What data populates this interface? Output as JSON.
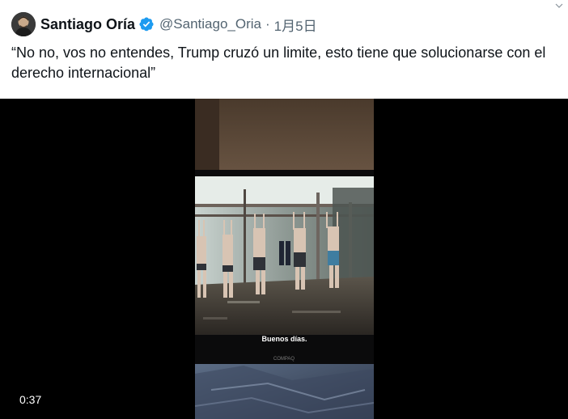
{
  "author": {
    "name": "Santiago Oría",
    "handle": "@Santiago_Oria",
    "separator": "·",
    "date": "1月5日",
    "avatar_icon": "avatar-photo",
    "verified_icon": "verified-badge-icon"
  },
  "tweet": {
    "text": "“No no, vos no entendes, Trump cruzó un limite, esto tiene que solucionarse con el derecho internacional”"
  },
  "video": {
    "subtitle": "Buenos días.",
    "brand": "COMPAQ",
    "duration": "0:37"
  },
  "colors": {
    "verified_blue": "#1d9bf0",
    "text_primary": "#0f1419",
    "text_secondary": "#536471"
  }
}
